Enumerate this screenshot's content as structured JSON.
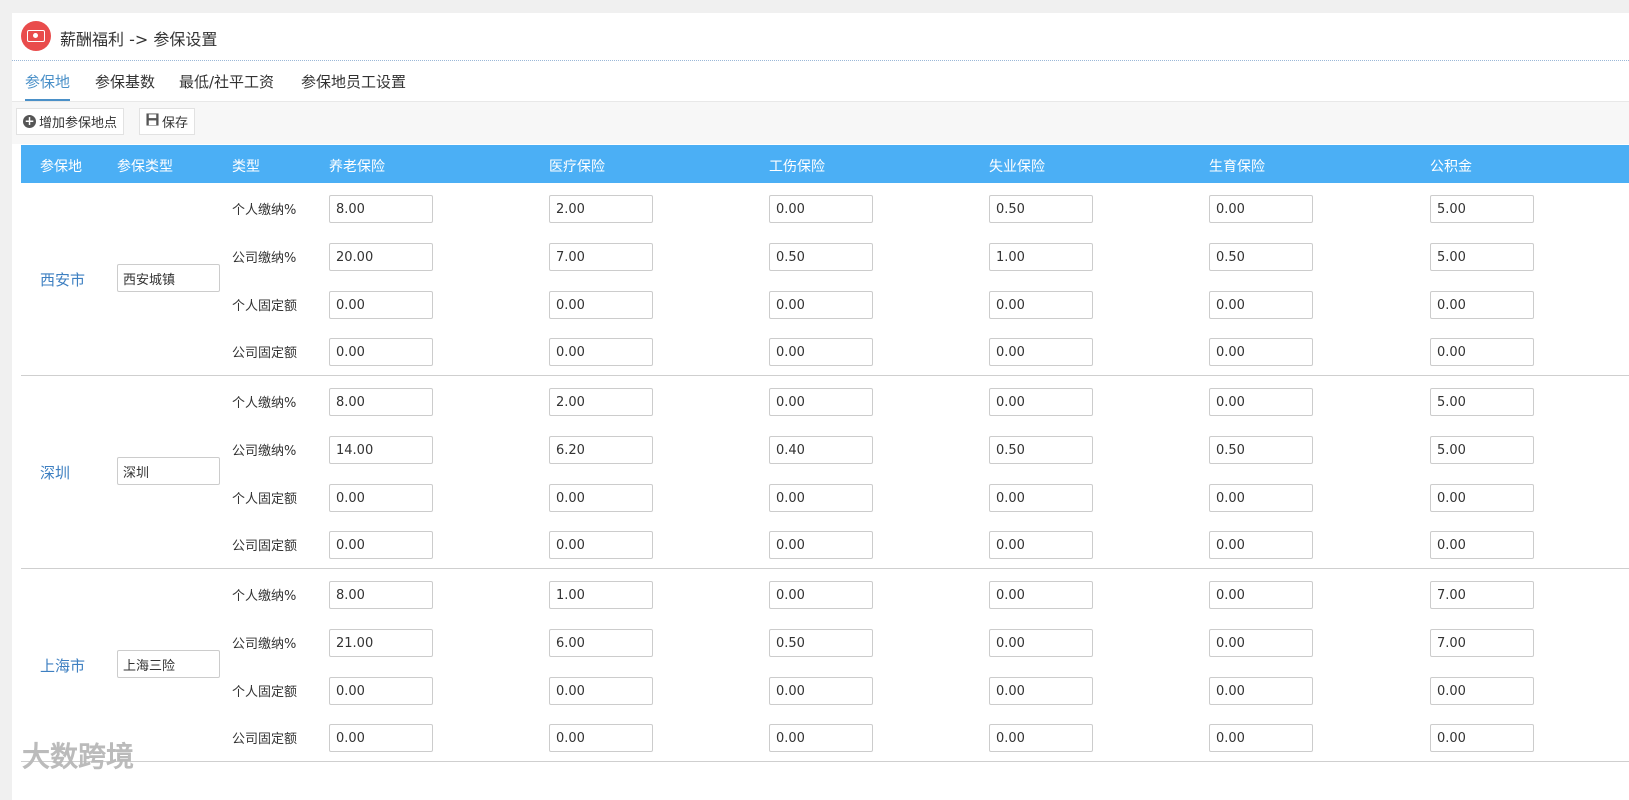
{
  "header": {
    "title": "薪酬福利 -> 参保设置"
  },
  "tabs": [
    {
      "label": "参保地",
      "active": true
    },
    {
      "label": "参保基数"
    },
    {
      "label": "最低/社平工资"
    },
    {
      "label": "参保地员工设置"
    }
  ],
  "toolbar": {
    "add_label": "增加参保地点",
    "save_label": "保存"
  },
  "table": {
    "headers": [
      "参保地",
      "参保类型",
      "类型",
      "养老保险",
      "医疗保险",
      "工伤保险",
      "失业保险",
      "生育保险",
      "公积金"
    ],
    "row_labels": [
      "个人缴纳%",
      "公司缴纳%",
      "个人固定额",
      "公司固定额"
    ],
    "groups": [
      {
        "city": "西安市",
        "type": "西安城镇",
        "rows": [
          [
            "8.00",
            "2.00",
            "0.00",
            "0.50",
            "0.00",
            "5.00"
          ],
          [
            "20.00",
            "7.00",
            "0.50",
            "1.00",
            "0.50",
            "5.00"
          ],
          [
            "0.00",
            "0.00",
            "0.00",
            "0.00",
            "0.00",
            "0.00"
          ],
          [
            "0.00",
            "0.00",
            "0.00",
            "0.00",
            "0.00",
            "0.00"
          ]
        ]
      },
      {
        "city": "深圳",
        "type": "深圳",
        "rows": [
          [
            "8.00",
            "2.00",
            "0.00",
            "0.00",
            "0.00",
            "5.00"
          ],
          [
            "14.00",
            "6.20",
            "0.40",
            "0.50",
            "0.50",
            "5.00"
          ],
          [
            "0.00",
            "0.00",
            "0.00",
            "0.00",
            "0.00",
            "0.00"
          ],
          [
            "0.00",
            "0.00",
            "0.00",
            "0.00",
            "0.00",
            "0.00"
          ]
        ]
      },
      {
        "city": "上海市",
        "type": "上海三险",
        "rows": [
          [
            "8.00",
            "1.00",
            "0.00",
            "0.00",
            "0.00",
            "7.00"
          ],
          [
            "21.00",
            "6.00",
            "0.50",
            "0.00",
            "0.00",
            "7.00"
          ],
          [
            "0.00",
            "0.00",
            "0.00",
            "0.00",
            "0.00",
            "0.00"
          ],
          [
            "0.00",
            "0.00",
            "0.00",
            "0.00",
            "0.00",
            "0.00"
          ]
        ]
      }
    ]
  },
  "watermark": "大数跨境",
  "colors": {
    "accent": "#4a90c8",
    "table_header": "#4baff5",
    "city_text": "#3d7fc1",
    "app_icon": "#e94c4c"
  }
}
